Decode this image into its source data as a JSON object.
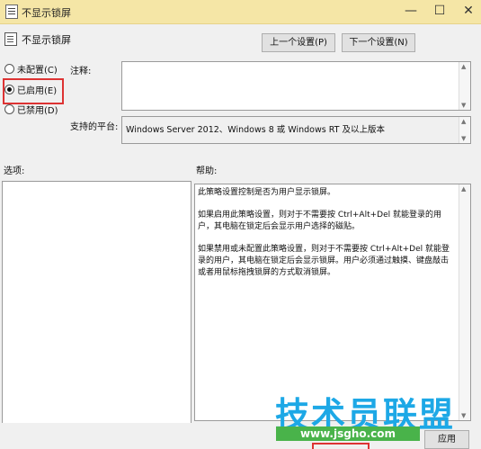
{
  "window": {
    "title": "不显示锁屏",
    "controls": {
      "minimize": "—",
      "maximize": "☐",
      "close": "✕"
    }
  },
  "header": {
    "title": "不显示锁屏",
    "prev_button": "上一个设置(P)",
    "next_button": "下一个设置(N)"
  },
  "state": {
    "options": [
      {
        "label": "未配置(C)",
        "selected": false
      },
      {
        "label": "已启用(E)",
        "selected": true
      },
      {
        "label": "已禁用(D)",
        "selected": false
      }
    ]
  },
  "comment": {
    "label": "注释:",
    "value": ""
  },
  "platform": {
    "label": "支持的平台:",
    "value": "Windows Server 2012、Windows 8 或 Windows RT 及以上版本"
  },
  "options_panel": {
    "label": "选项:"
  },
  "help_panel": {
    "label": "帮助:",
    "paragraphs": [
      "此策略设置控制是否为用户显示锁屏。",
      "如果启用此策略设置，则对于不需要按 Ctrl+Alt+Del 就能登录的用户，其电脑在锁定后会显示用户选择的磁贴。",
      "如果禁用或未配置此策略设置，则对于不需要按 Ctrl+Alt+Del 就能登录的用户，其电脑在锁定后会显示锁屏。用户必须通过触摸、键盘敲击或者用鼠标拖拽锁屏的方式取消锁屏。"
    ]
  },
  "footer": {
    "apply_button": "应用"
  },
  "watermark": {
    "brand": "技术员联盟",
    "url": "www.jsgho.com"
  },
  "colors": {
    "titlebar": "#f5e6a6",
    "highlight": "#dd3333",
    "watermark_blue": "#1da8e6",
    "watermark_green": "#49b34a"
  }
}
